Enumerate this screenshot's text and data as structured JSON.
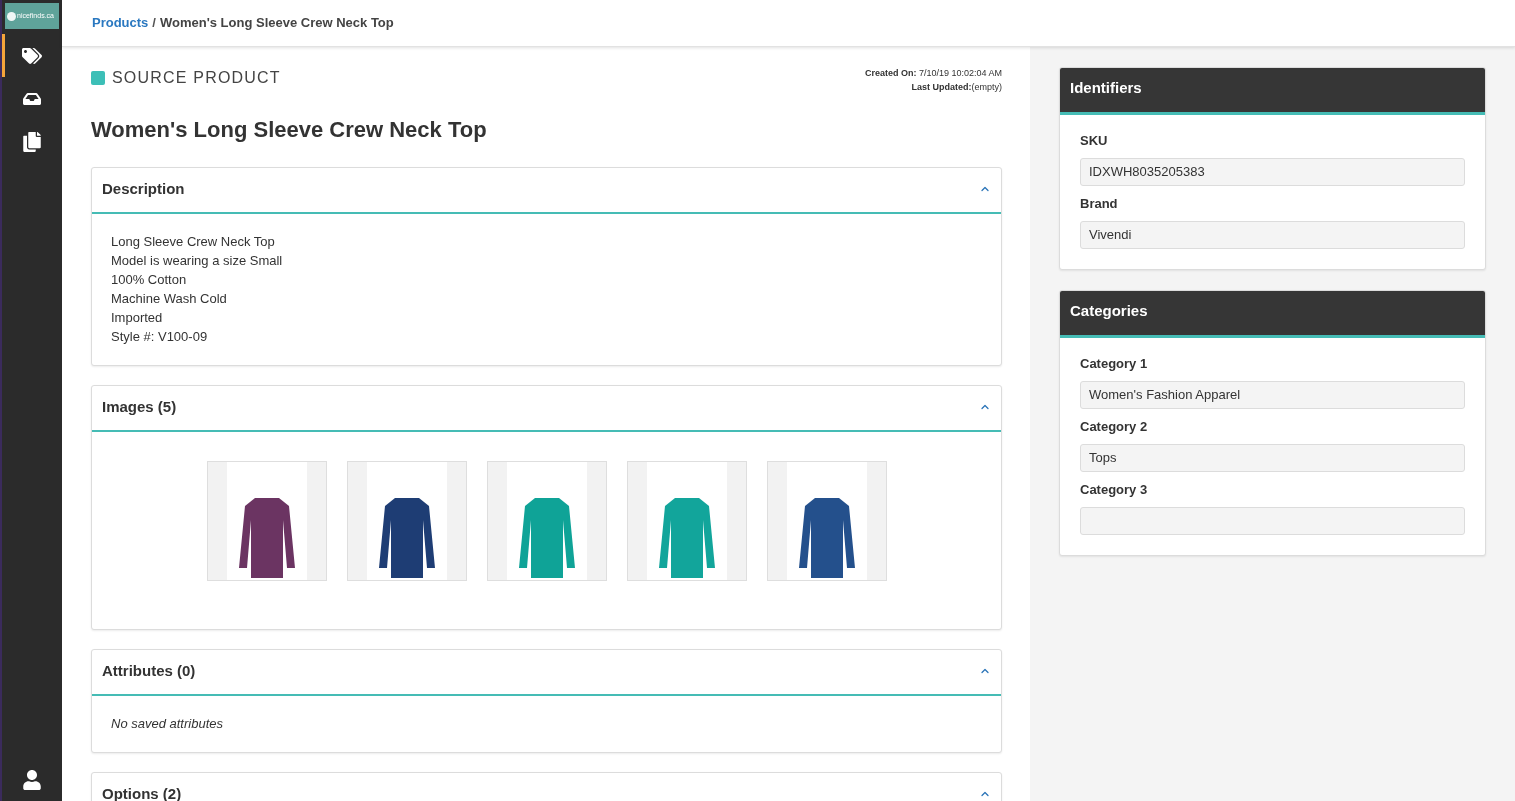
{
  "sidebar": {
    "logo": "nicefinds.ca",
    "items": [
      {
        "kind": "tags",
        "selected": true
      },
      {
        "kind": "inbox",
        "selected": false
      },
      {
        "kind": "copy",
        "selected": false
      }
    ]
  },
  "breadcrumb": {
    "link": "Products",
    "separator": "/",
    "current": "Women's Long Sleeve Crew Neck Top"
  },
  "header": {
    "label": "SOURCE PRODUCT",
    "meta": [
      "**Created On:** 7/10/19 10:02:04 AM",
      "**Last Updated:**(empty)"
    ],
    "title": "Women's Long Sleeve Crew Neck Top"
  },
  "sections": [
    {
      "kind": "text",
      "title": "Description",
      "expanded": true,
      "lines": [
        "Long Sleeve Crew Neck Top",
        "Model is wearing a size Small",
        "100% Cotton",
        "Machine Wash Cold",
        "Imported",
        "Style #: V100-09"
      ]
    },
    {
      "kind": "images",
      "title": "Images (5)",
      "expanded": true,
      "images": [
        {
          "color": "#6b3462"
        },
        {
          "color": "#1e3d74"
        },
        {
          "color": "#0fa397"
        },
        {
          "color": "#12a59b"
        },
        {
          "color": "#24508c"
        }
      ]
    },
    {
      "kind": "empty",
      "title": "Attributes (0)",
      "expanded": true,
      "message": "No saved attributes"
    },
    {
      "kind": "options",
      "title": "Options (2)",
      "expanded": true
    }
  ],
  "panels": [
    {
      "title": "Identifiers",
      "fields": [
        {
          "label": "SKU",
          "value": "IDXWH8035205383"
        },
        {
          "label": "Brand",
          "value": "Vivendi"
        }
      ]
    },
    {
      "title": "Categories",
      "fields": [
        {
          "label": "Category 1",
          "value": "Women's Fashion Apparel"
        },
        {
          "label": "Category 2",
          "value": "Tops"
        },
        {
          "label": "Category 3"
        }
      ]
    }
  ]
}
